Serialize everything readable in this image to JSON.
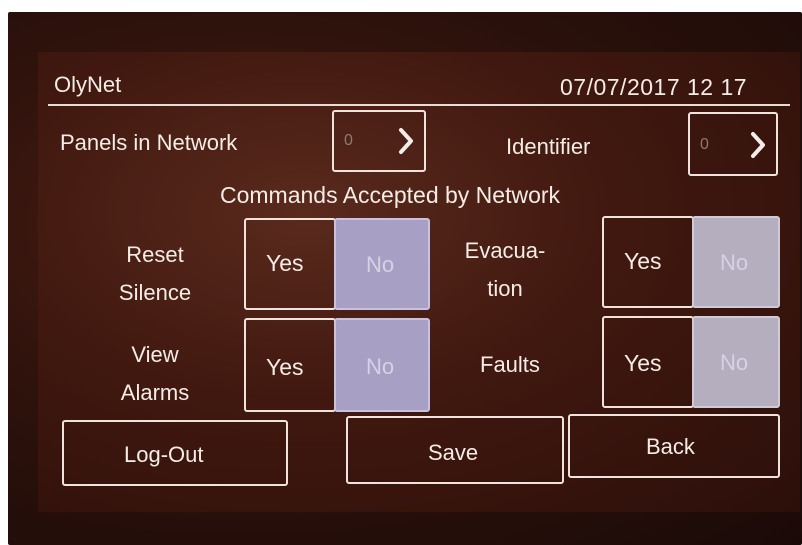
{
  "header": {
    "app_title": "OlyNet",
    "datetime": "07/07/2017 12 17"
  },
  "network": {
    "panels_label": "Panels in Network",
    "panels_value": "0",
    "identifier_label": "Identifier",
    "identifier_value": "0"
  },
  "commands": {
    "section_title": "Commands Accepted by Network",
    "items": [
      {
        "label_line1": "Reset",
        "label_line2": "Silence",
        "yes": "Yes",
        "no": "No",
        "selected": "No"
      },
      {
        "label_line1": "Evacua-",
        "label_line2": "tion",
        "yes": "Yes",
        "no": "No",
        "selected": "No"
      },
      {
        "label_line1": "View",
        "label_line2": "Alarms",
        "yes": "Yes",
        "no": "No",
        "selected": "No"
      },
      {
        "label_line1": "Faults",
        "label_line2": "",
        "yes": "Yes",
        "no": "No",
        "selected": "No"
      }
    ]
  },
  "footer": {
    "logout_label": "Log-Out",
    "save_label": "Save",
    "back_label": "Back"
  },
  "colors": {
    "screen_background": "#40180f",
    "foreground": "#f4ece6",
    "no_selected_fill": "#a8a0c4"
  },
  "icons": {
    "stepper_next": "chevron-right-icon"
  }
}
